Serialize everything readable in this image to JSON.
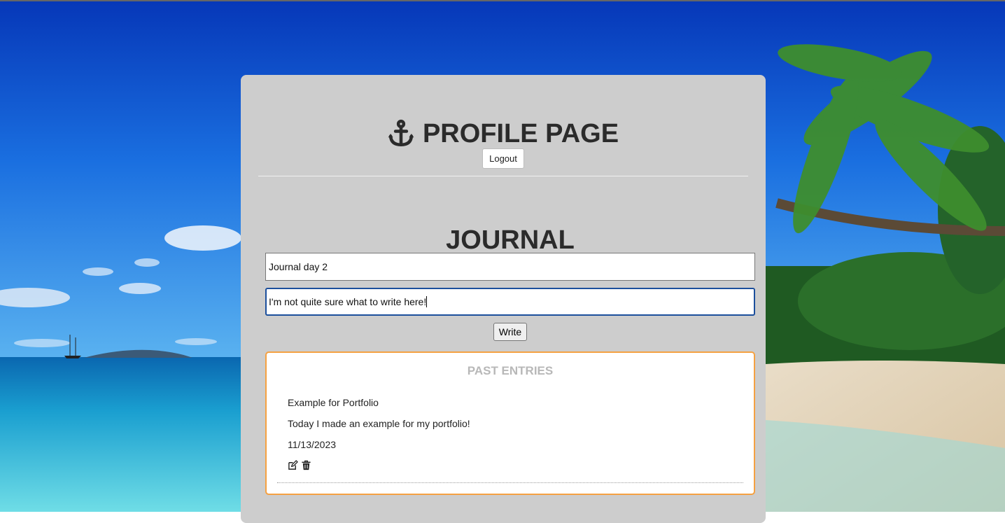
{
  "header": {
    "title": "PROFILE PAGE",
    "icon": "anchor-icon",
    "logout_label": "Logout"
  },
  "journal": {
    "title": "JOURNAL",
    "title_input_value": "Journal day 2",
    "body_input_value": "I'm not quite sure what to write here!",
    "write_label": "Write"
  },
  "past_entries": {
    "heading": "PAST ENTRIES",
    "entries": [
      {
        "title": "Example for Portfolio",
        "body": "Today I made an example for my portfolio!",
        "date": "11/13/2023"
      }
    ]
  },
  "colors": {
    "card_bg": "#cdcdcd",
    "entries_border": "#f5a142",
    "focus_border": "#1c4f9c",
    "heading_text": "#2b2b2b",
    "entries_heading": "#b8b8b8"
  }
}
